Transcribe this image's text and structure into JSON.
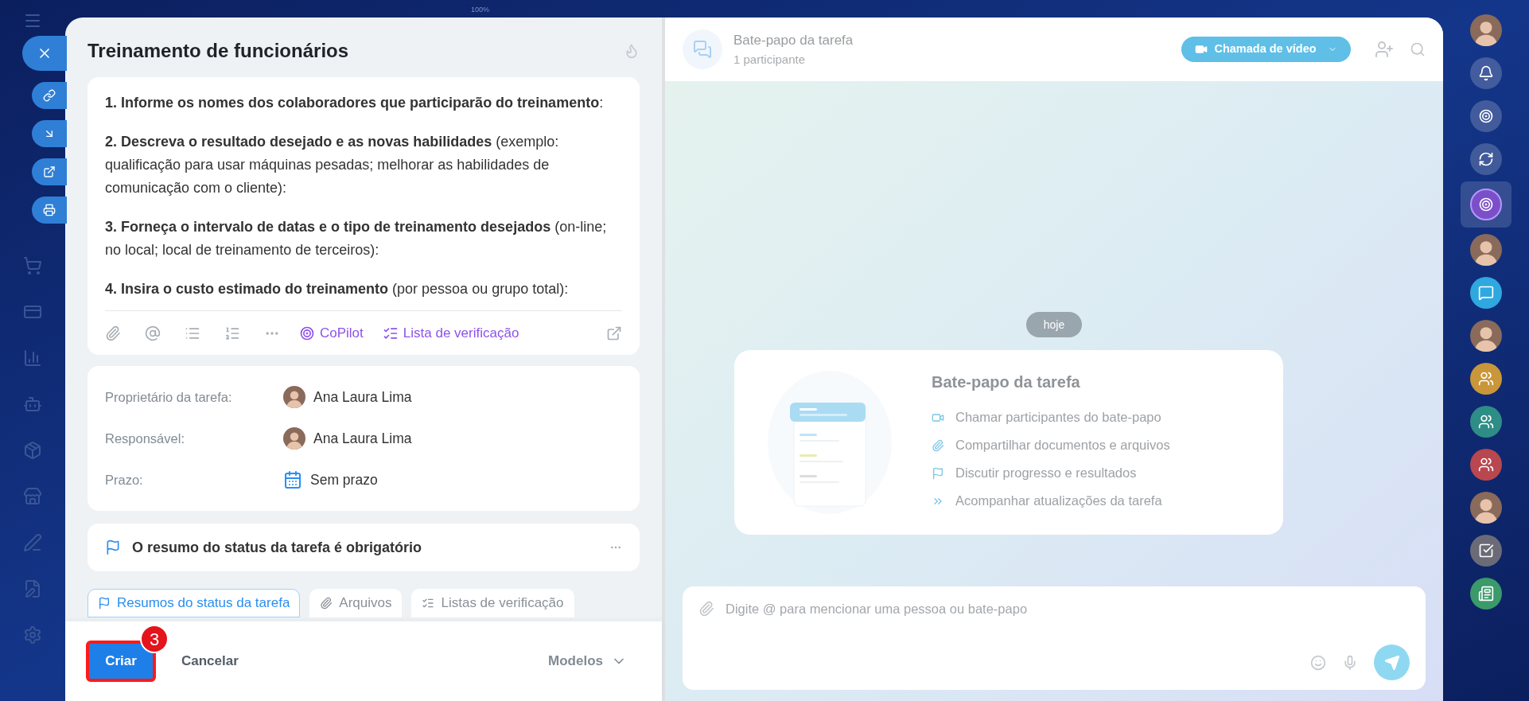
{
  "zoom_label": "100%",
  "left_sidebar": [
    {
      "kind": "menu"
    },
    {
      "kind": "cart"
    },
    {
      "kind": "card"
    },
    {
      "kind": "chart"
    },
    {
      "kind": "robot"
    },
    {
      "kind": "box"
    },
    {
      "kind": "store"
    },
    {
      "kind": "pen"
    },
    {
      "kind": "doc"
    },
    {
      "kind": "settings"
    }
  ],
  "floating_actions": [
    {
      "kind": "close"
    },
    {
      "kind": "link"
    },
    {
      "kind": "download"
    },
    {
      "kind": "open"
    },
    {
      "kind": "print"
    }
  ],
  "task": {
    "title": "Treinamento de funcionários",
    "description": [
      "**1. Informe os nomes dos colaboradores que participarão do treinamento**:",
      "**2. Descreva o resultado desejado e as novas habilidades** (exemplo: qualificação para usar máquinas pesadas; melhorar as habilidades de comunicação com o cliente):",
      "**3. Forneça o intervalo de datas e o tipo de treinamento desejados** (on-line; no local; local de treinamento de terceiros):",
      "**4. Insira o custo estimado do treinamento** (por pessoa ou grupo total):"
    ],
    "copilot": "CoPilot",
    "checklist": "Lista de verificação",
    "fields": [
      {
        "label": "Proprietário da tarefa:",
        "value": "Ana Laura Lima",
        "kind": "person"
      },
      {
        "label": "Responsável:",
        "value": "Ana Laura Lima",
        "kind": "person"
      },
      {
        "label": "Prazo:",
        "value": "Sem prazo",
        "kind": "deadline"
      }
    ],
    "status_summary": "O resumo do status da tarefa é obrigatório",
    "tabs": [
      {
        "label": "Resumos do status da tarefa",
        "kind": "summary",
        "selected": true
      },
      {
        "label": "Arquivos",
        "kind": "files",
        "selected": false
      },
      {
        "label": "Listas de verificação",
        "kind": "checklists",
        "selected": false
      }
    ],
    "create": "Criar",
    "step_badge": "3",
    "cancel": "Cancelar",
    "templates": "Modelos"
  },
  "chat": {
    "title": "Bate-papo da tarefa",
    "subtitle": "1 participante",
    "video_call": "Chamada de vídeo",
    "date": "hoje",
    "intro_title": "Bate-papo da tarefa",
    "features": [
      {
        "kind": "video",
        "text": "Chamar participantes do bate-papo"
      },
      {
        "kind": "clip",
        "text": "Compartilhar documentos e arquivos"
      },
      {
        "kind": "flag",
        "text": "Discutir progresso e resultados"
      },
      {
        "kind": "forward",
        "text": "Acompanhar atualizações da tarefa"
      }
    ],
    "input_placeholder": "Digite @ para mencionar uma pessoa ou bate-papo"
  },
  "right_sidebar": [
    {
      "kind": "avatar",
      "selected": false
    },
    {
      "kind": "bell",
      "selected": false
    },
    {
      "kind": "copilot",
      "selected": false
    },
    {
      "kind": "transfer",
      "selected": false
    },
    {
      "kind": "copilot-app",
      "selected": true
    },
    {
      "kind": "avatar",
      "selected": false
    },
    {
      "kind": "chat",
      "selected": false
    },
    {
      "kind": "avatar",
      "selected": false
    },
    {
      "kind": "group",
      "color": "#c9963a",
      "selected": false
    },
    {
      "kind": "group",
      "color": "#2e8d86",
      "selected": false
    },
    {
      "kind": "group",
      "color": "#b8474f",
      "selected": false
    },
    {
      "kind": "avatar",
      "selected": false
    },
    {
      "kind": "task",
      "selected": false
    },
    {
      "kind": "news",
      "selected": false
    }
  ]
}
